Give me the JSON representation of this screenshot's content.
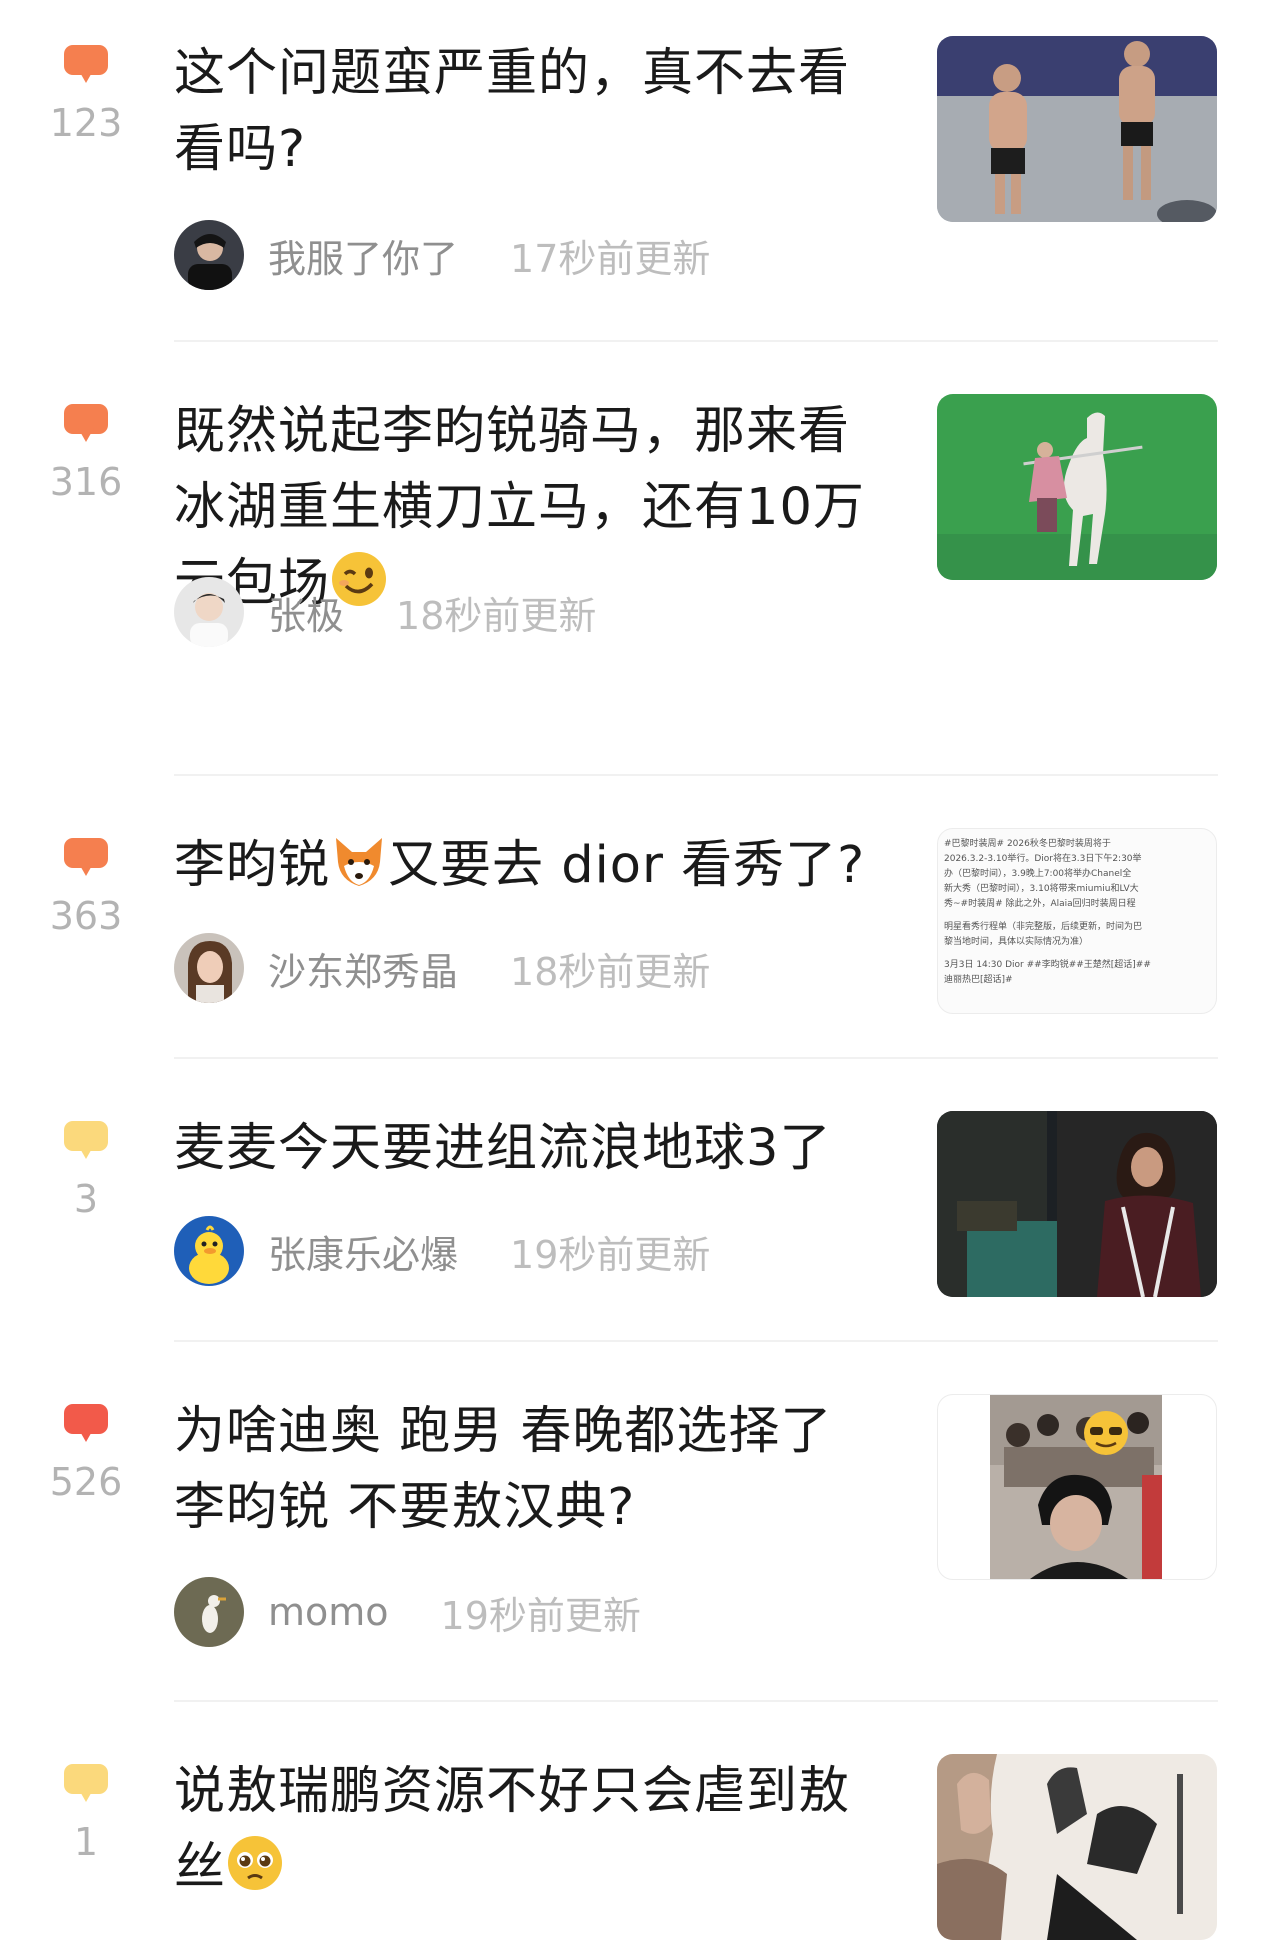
{
  "posts": [
    {
      "count": "123",
      "bubble_color": "#f57f4f",
      "title_lines": [
        "这个问题蛮严重的，真不去看",
        "看吗?"
      ],
      "author": "我服了你了",
      "time": "17秒前更新"
    },
    {
      "count": "316",
      "bubble_color": "#f57f4f",
      "title_lines": [
        "既然说起李昀锐骑马，那来看",
        "冰湖重生横刀立马，还有10万",
        "云包场"
      ],
      "title_emoji": "winking-face-emoji",
      "author": "张极",
      "time": "18秒前更新"
    },
    {
      "count": "363",
      "bubble_color": "#f57f4f",
      "title_before": "李昀锐",
      "title_emoji": "fox-emoji",
      "title_after": "又要去 dior 看秀了?",
      "author": "沙东郑秀晶",
      "time": "18秒前更新",
      "thumb_text": [
        "#巴黎时装周# 2026秋冬巴黎时装周将于",
        "2026.3.2-3.10举行。Dior将在3.3日下午2:30举",
        "办（巴黎时间），3.9晚上7:00将举办Chanel全",
        "新大秀（巴黎时间），3.10将带来miumiu和LV大",
        "秀~#时装周# 除此之外，Alaia回归时装周日程",
        "明星看秀行程单（非完整版，后续更新，时间为巴",
        "黎当地时间，具体以实际情况为准）",
        "3月3日 14:30 Dior ##李昀锐##王楚然[超话]##",
        "迪丽热巴[超话]#"
      ]
    },
    {
      "count": "3",
      "bubble_color": "#fbd97c",
      "title_lines": [
        "麦麦今天要进组流浪地球3了"
      ],
      "author": "张康乐必爆",
      "time": "19秒前更新"
    },
    {
      "count": "526",
      "bubble_color": "#f25a4a",
      "title_lines": [
        "为啥迪奥 跑男 春晚都选择了",
        "李昀锐 不要敖汉典?"
      ],
      "author": "momo",
      "time": "19秒前更新"
    },
    {
      "count": "1",
      "bubble_color": "#fbd97c",
      "title_lines": [
        "说敖瑞鹏资源不好只会虐到敖",
        "丝"
      ],
      "title_emoji": "pleading-face-emoji",
      "author": "",
      "time": ""
    }
  ]
}
